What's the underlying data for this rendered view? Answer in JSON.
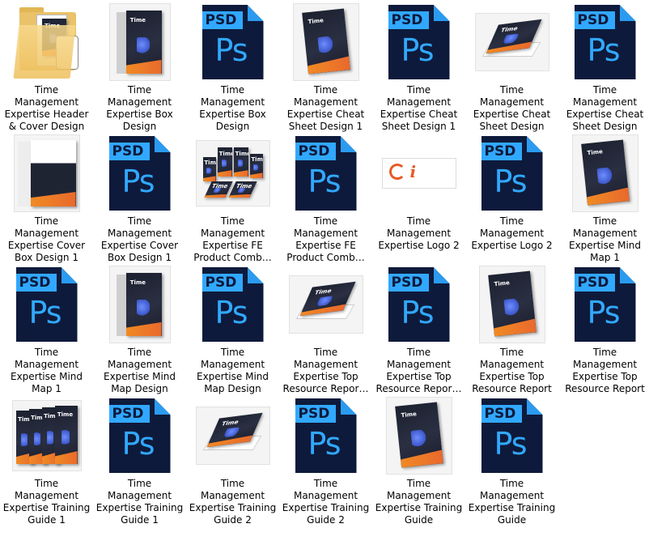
{
  "files": [
    {
      "icon": "folder-icon",
      "label": "Time\nManagement\nExpertise Header\n& Cover Design"
    },
    {
      "icon": "box-mockup-icon",
      "label": "Time\nManagement\nExpertise Box\nDesign"
    },
    {
      "icon": "psd-file-icon",
      "label": "Time\nManagement\nExpertise Box\nDesign"
    },
    {
      "icon": "book-mockup-icon",
      "label": "Time\nManagement\nExpertise Cheat\nSheet Design 1"
    },
    {
      "icon": "psd-file-icon",
      "label": "Time\nManagement\nExpertise Cheat\nSheet Design 1"
    },
    {
      "icon": "book-flat-mockup-icon",
      "label": "Time\nManagement\nExpertise Cheat\nSheet Design"
    },
    {
      "icon": "psd-file-icon",
      "label": "Time\nManagement\nExpertise Cheat\nSheet Design"
    },
    {
      "icon": "cover-box-mockup-icon",
      "label": "Time\nManagement\nExpertise Cover\nBox Design 1"
    },
    {
      "icon": "psd-file-icon",
      "label": "Time\nManagement\nExpertise Cover\nBox Design 1"
    },
    {
      "icon": "bundle-mockup-icon",
      "label": "Time\nManagement\nExpertise FE\nProduct Comb…"
    },
    {
      "icon": "psd-file-icon",
      "label": "Time\nManagement\nExpertise FE\nProduct Comb…"
    },
    {
      "icon": "logo-image-icon",
      "label": "Time\nManagement\nExpertise Logo 2"
    },
    {
      "icon": "psd-file-icon",
      "label": "Time\nManagement\nExpertise Logo 2"
    },
    {
      "icon": "book-mockup-icon",
      "label": "Time\nManagement\nExpertise Mind\nMap 1"
    },
    {
      "icon": "psd-file-icon",
      "label": "Time\nManagement\nExpertise Mind\nMap 1"
    },
    {
      "icon": "box-mockup-icon",
      "label": "Time\nManagement\nExpertise Mind\nMap Design"
    },
    {
      "icon": "psd-file-icon",
      "label": "Time\nManagement\nExpertise Mind\nMap Design"
    },
    {
      "icon": "book-flat-mockup-icon",
      "label": "Time\nManagement\nExpertise Top\nResource Repor…"
    },
    {
      "icon": "psd-file-icon",
      "label": "Time\nManagement\nExpertise Top\nResource Repor…"
    },
    {
      "icon": "book-mockup-icon",
      "label": "Time\nManagement\nExpertise Top\nResource Report"
    },
    {
      "icon": "psd-file-icon",
      "label": "Time\nManagement\nExpertise Top\nResource Report"
    },
    {
      "icon": "binders-mockup-icon",
      "label": "Time\nManagement\nExpertise Training\nGuide 1"
    },
    {
      "icon": "psd-file-icon",
      "label": "Time\nManagement\nExpertise Training\nGuide 1"
    },
    {
      "icon": "book-flat-mockup-icon",
      "label": "Time\nManagement\nExpertise Training\nGuide 2"
    },
    {
      "icon": "psd-file-icon",
      "label": "Time\nManagement\nExpertise Training\nGuide 2"
    },
    {
      "icon": "book-mockup-icon",
      "label": "Time\nManagement\nExpertise Training\nGuide"
    },
    {
      "icon": "psd-file-icon",
      "label": "Time\nManagement\nExpertise Training\nGuide"
    }
  ],
  "psd_icon": {
    "banner_text": "PSD",
    "glyph_text": "Ps"
  },
  "mockup_text": "Time",
  "colors": {
    "psd_dark": "#0e1a3b",
    "psd_blue": "#31a8ff",
    "accent_orange": "#f08a24",
    "folder": "#eebf5b"
  }
}
